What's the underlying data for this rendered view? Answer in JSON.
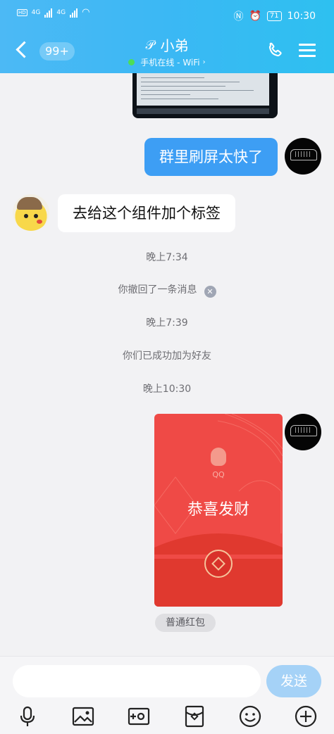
{
  "status_bar": {
    "network_left": "4G",
    "network_right": "4G",
    "battery": "71",
    "time": "10:30"
  },
  "header": {
    "unread_badge": "99+",
    "contact_name": "小弟",
    "online_status": "手机在线 - WiFi",
    "colors": {
      "gradient_start": "#4cb9f5",
      "gradient_end": "#2ec0f0"
    }
  },
  "messages": [
    {
      "type": "image",
      "from": "me",
      "content": "screenshot"
    },
    {
      "type": "text",
      "from": "me",
      "text": "群里刷屏太快了"
    },
    {
      "type": "text",
      "from": "friend",
      "text": "去给这个组件加个标签"
    },
    {
      "type": "system",
      "text": "晚上7:34"
    },
    {
      "type": "system",
      "text": "你撤回了一条消息"
    },
    {
      "type": "system",
      "text": "晚上7:39"
    },
    {
      "type": "system",
      "text": "你们已成功加为好友"
    },
    {
      "type": "system",
      "text": "晚上10:30"
    },
    {
      "type": "red_packet",
      "from": "me",
      "brand": "QQ",
      "greeting": "恭喜发财",
      "kind": "普通红包"
    }
  ],
  "composer": {
    "input_value": "",
    "input_placeholder": "",
    "send_label": "发送"
  },
  "toolbar": {
    "icons": [
      "microphone-icon",
      "image-icon",
      "video-icon",
      "red-packet-icon",
      "emoji-icon",
      "plus-icon"
    ]
  },
  "colors": {
    "my_bubble": "#3d9ef4",
    "red_packet": "#ef4a46",
    "send_button": "#a5d2f7"
  }
}
